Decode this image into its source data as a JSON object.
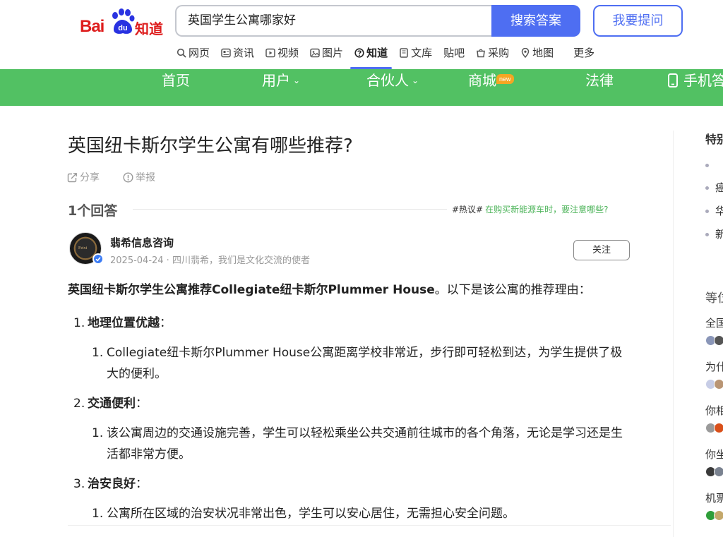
{
  "brand": {
    "bai": "Bai",
    "du": "du",
    "zhidao": "知道"
  },
  "search": {
    "query": "英国学生公寓哪家好",
    "button_label": "搜索答案",
    "ask_label": "我要提问"
  },
  "tabs": [
    {
      "label": "网页",
      "icon": "search-icon"
    },
    {
      "label": "资讯",
      "icon": "news-icon"
    },
    {
      "label": "视频",
      "icon": "video-icon"
    },
    {
      "label": "图片",
      "icon": "image-icon"
    },
    {
      "label": "知道",
      "icon": "question-icon",
      "active": true
    },
    {
      "label": "文库",
      "icon": "document-icon"
    },
    {
      "label": "贴吧",
      "icon": ""
    },
    {
      "label": "采购",
      "icon": "shopping-icon"
    },
    {
      "label": "地图",
      "icon": "map-icon"
    },
    {
      "label": "更多",
      "icon": ""
    }
  ],
  "nav": {
    "home": "首页",
    "users": "用户",
    "partner": "合伙人",
    "mall": "商城",
    "mall_badge": "new",
    "law": "法律",
    "mobile": "手机答"
  },
  "question": {
    "title": "英国纽卡斯尔学生公寓有哪些推荐?",
    "share": "分享",
    "report": "举报"
  },
  "answers_header": {
    "count": "1个回答",
    "hot_tag": "#热议#",
    "hot_link": "在购买新能源车时，要注意哪些?"
  },
  "answer": {
    "author": "翡希信息咨询",
    "meta": "2025-04-24 · 四川翡希，我们是文化交流的使者",
    "follow": "关注",
    "avatar_text": "Feixi",
    "lead_bold": "英国纽卡斯尔学生公寓推荐Collegiate纽卡斯尔Plummer House",
    "lead_rest": "。以下是该公寓的推荐理由：",
    "points": [
      {
        "num": "1.",
        "title": "地理位置优越",
        "colon": "：",
        "sub_num": "1.",
        "sub": "Collegiate纽卡斯尔Plummer House公寓距离学校非常近，步行即可轻松到达，为学生提供了极大的便利。"
      },
      {
        "num": "2.",
        "title": "交通便利",
        "colon": "：",
        "sub_num": "1.",
        "sub": "该公寓周边的交通设施完善，学生可以轻松乘坐公共交通前往城市的各个角落，无论是学习还是生活都非常方便。"
      },
      {
        "num": "3.",
        "title": "治安良好",
        "colon": "：",
        "sub_num": "1.",
        "sub": "公寓所在区域的治安状况非常出色，学生可以安心居住，无需担心安全问题。"
      }
    ]
  },
  "sidebar": {
    "title1": "特别",
    "bullets": [
      "",
      "癌",
      "华",
      "新"
    ],
    "title2": "等位",
    "questions": [
      "全国",
      "为什",
      "你相",
      "你坐",
      "机票"
    ]
  },
  "colors": {
    "accent": "#4e6ef2",
    "nav_green": "#52c163",
    "brand_red": "#de1d1d",
    "hot_link": "#4db45a"
  }
}
